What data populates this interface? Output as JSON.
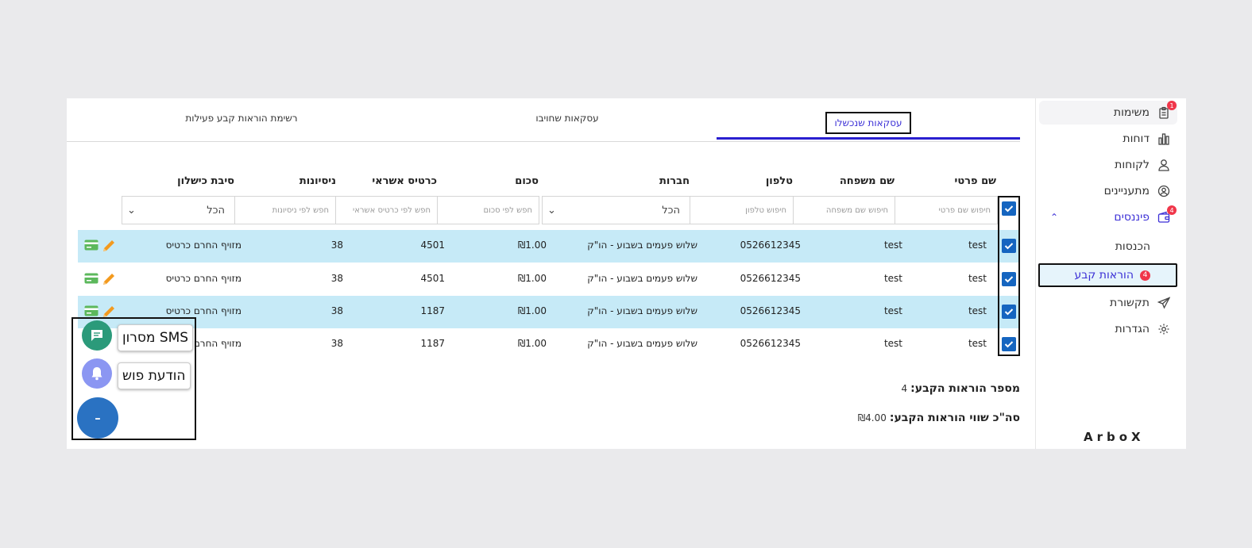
{
  "sidebar": {
    "items": [
      {
        "label": "משימות",
        "icon": "clipboard-icon",
        "badge": "1"
      },
      {
        "label": "דוחות",
        "icon": "bar-chart-icon"
      },
      {
        "label": "לקוחות",
        "icon": "user-icon"
      },
      {
        "label": "מתעניינים",
        "icon": "user-circle-icon"
      },
      {
        "label": "פיננסים",
        "icon": "wallet-icon",
        "badge": "4"
      },
      {
        "label": "הכנסות"
      },
      {
        "label": "הוראות קבע",
        "badge": "4"
      },
      {
        "label": "תקשורת",
        "icon": "send-icon"
      },
      {
        "label": "הגדרות",
        "icon": "gear-icon"
      }
    ],
    "brand": "ArboX"
  },
  "tabs": [
    "עסקאות שנכשלו",
    "עסקאות שחויבו",
    "רשימת הוראות קבע פעילות"
  ],
  "columns": [
    "שם פרטי",
    "שם משפחה",
    "טלפון",
    "חברות",
    "סכום",
    "כרטיס אשראי",
    "ניסיונות",
    "סיבת כישלון"
  ],
  "filters": {
    "first_name": "חיפוש שם פרטי",
    "last_name": "חיפוש שם משפחה",
    "phone": "חיפוש טלפון",
    "membership": "הכל",
    "amount": "חפש לפי סכום",
    "card": "חפש לפי כרטיס אשראי",
    "attempts": "חפש לפי ניסיונות",
    "reason": "הכל"
  },
  "rows": [
    {
      "first": "test",
      "last": "test",
      "phone": "0526612345",
      "membership": "שלוש פעמים בשבוע - הו\"ק",
      "amount": "₪1.00",
      "card": "4501",
      "attempts": "38",
      "reason": "מזויף החרם כרטיס"
    },
    {
      "first": "test",
      "last": "test",
      "phone": "0526612345",
      "membership": "שלוש פעמים בשבוע - הו\"ק",
      "amount": "₪1.00",
      "card": "4501",
      "attempts": "38",
      "reason": "מזויף החרם כרטיס"
    },
    {
      "first": "test",
      "last": "test",
      "phone": "0526612345",
      "membership": "שלוש פעמים בשבוע - הו\"ק",
      "amount": "₪1.00",
      "card": "1187",
      "attempts": "38",
      "reason": "מזויף החרם כרטיס"
    },
    {
      "first": "test",
      "last": "test",
      "phone": "0526612345",
      "membership": "שלוש פעמים בשבוע - הו\"ק",
      "amount": "₪1.00",
      "card": "1187",
      "attempts": "38",
      "reason": "מזויף החרם כרטיס"
    }
  ],
  "summary": {
    "count_label": "מספר הוראות הקבע:",
    "count_value": "4",
    "total_label": "סה\"כ שווי הוראות הקבע:",
    "total_value": "₪4.00"
  },
  "fab": {
    "sms_label": "מסרון SMS",
    "push_label": "הודעת פוש",
    "main_symbol": "-"
  },
  "colors": {
    "accent": "#3b2fd6",
    "row_highlight": "#c6eaf7",
    "checkbox": "#1565c0",
    "badge": "#f0364a"
  }
}
